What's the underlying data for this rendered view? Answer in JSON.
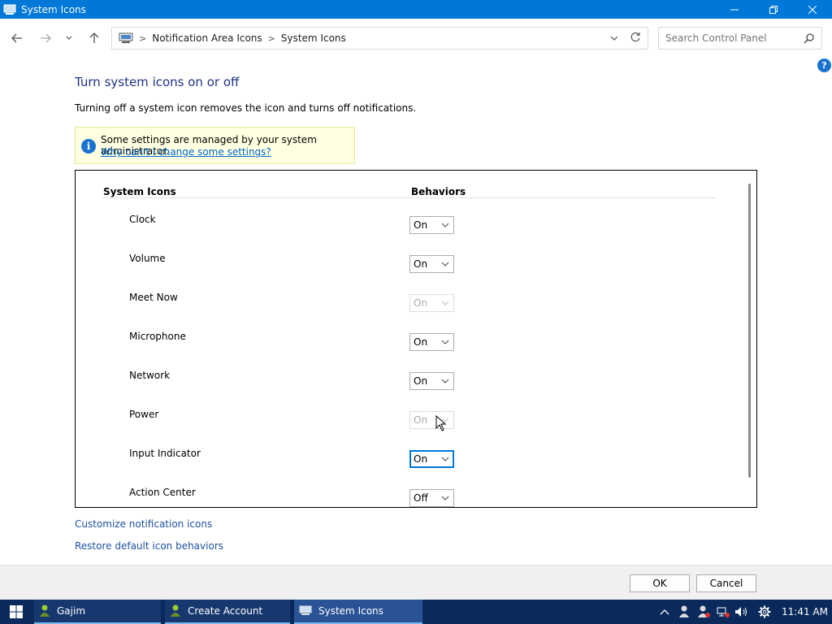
{
  "window": {
    "title": "System Icons",
    "controls": {
      "minimize": "—",
      "maximize": "❐",
      "close": "✕"
    }
  },
  "nav": {
    "breadcrumbs": [
      "Notification Area Icons",
      "System Icons"
    ],
    "search_placeholder": "Search Control Panel",
    "help": "?"
  },
  "main": {
    "heading": "Turn system icons on or off",
    "description": "Turning off a system icon removes the icon and turns off notifications.",
    "info": {
      "message": "Some settings are managed by your system administrator.",
      "link": "Why can't I change some settings?"
    },
    "columns": {
      "icons": "System Icons",
      "behaviors": "Behaviors"
    },
    "rows": [
      {
        "label": "Clock",
        "value": "On"
      },
      {
        "label": "Volume",
        "value": "On"
      },
      {
        "label": "Meet Now",
        "value": "On"
      },
      {
        "label": "Microphone",
        "value": "On"
      },
      {
        "label": "Network",
        "value": "On"
      },
      {
        "label": "Power",
        "value": "On"
      },
      {
        "label": "Input Indicator",
        "value": "On"
      },
      {
        "label": "Action Center",
        "value": "Off"
      }
    ],
    "links": {
      "customize": "Customize notification icons",
      "restore": "Restore default icon behaviors"
    }
  },
  "footer": {
    "ok": "OK",
    "cancel": "Cancel"
  },
  "taskbar": {
    "tasks": [
      "Gajim",
      "Create Account",
      "System Icons"
    ],
    "time": "11:41 AM"
  },
  "colors": {
    "titlebar": "#0078d7",
    "heading": "#1e3287",
    "link": "#1e50a2",
    "info_bg": "#ffffe1",
    "taskbar": "#0a2a5c"
  }
}
